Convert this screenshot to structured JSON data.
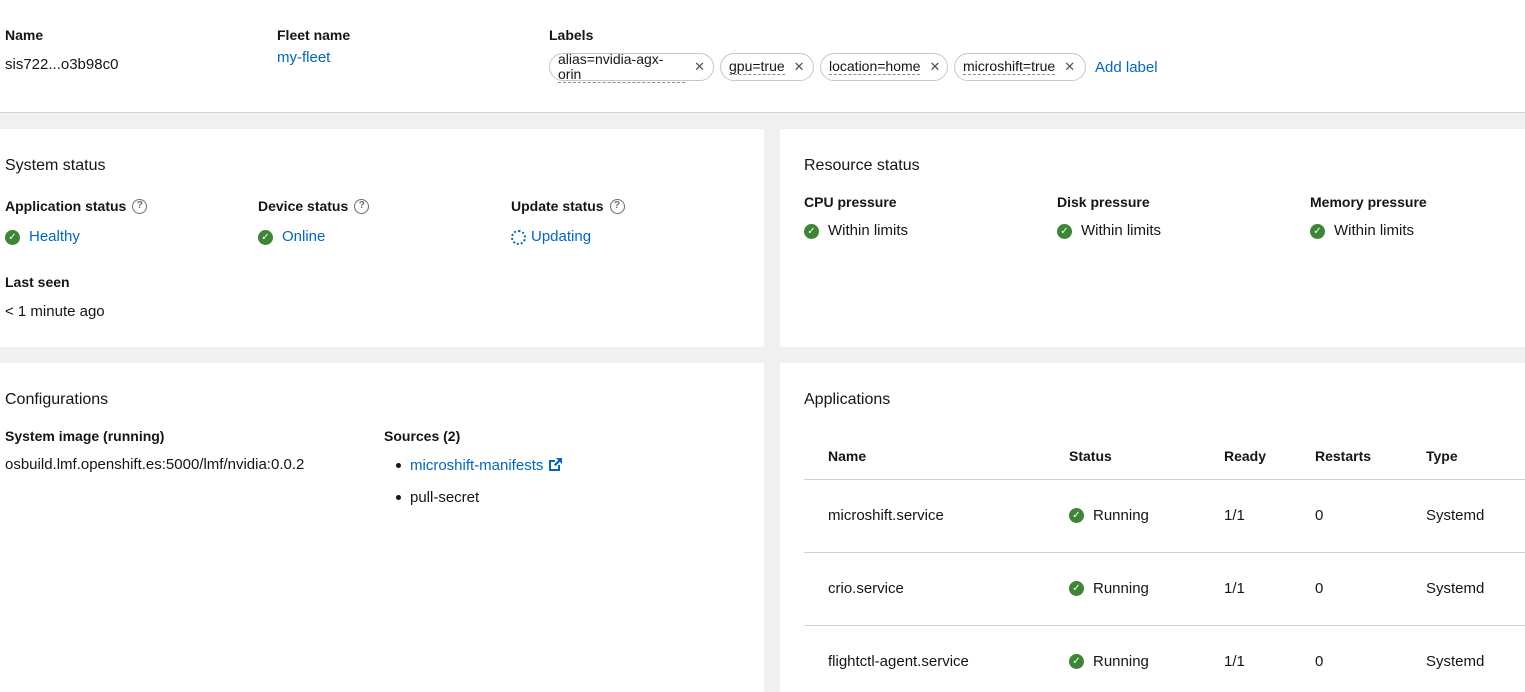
{
  "header": {
    "name_label": "Name",
    "name_value": "sis722...o3b98c0",
    "fleet_label": "Fleet name",
    "fleet_value": "my-fleet",
    "labels_label": "Labels",
    "labels": [
      "alias=nvidia-agx-orin",
      "gpu=true",
      "location=home",
      "microshift=true"
    ],
    "add_label": "Add label"
  },
  "system_status": {
    "title": "System status",
    "app_status_label": "Application status",
    "app_status_value": "Healthy",
    "device_status_label": "Device status",
    "device_status_value": "Online",
    "update_status_label": "Update status",
    "update_status_value": "Updating",
    "last_seen_label": "Last seen",
    "last_seen_value": "< 1 minute ago"
  },
  "resource_status": {
    "title": "Resource status",
    "cpu_label": "CPU pressure",
    "cpu_value": "Within limits",
    "disk_label": "Disk pressure",
    "disk_value": "Within limits",
    "memory_label": "Memory pressure",
    "memory_value": "Within limits"
  },
  "configurations": {
    "title": "Configurations",
    "system_image_label": "System image (running)",
    "system_image_value": "osbuild.lmf.openshift.es:5000/lmf/nvidia:0.0.2",
    "sources_label": "Sources (2)",
    "sources": [
      "microshift-manifests",
      "pull-secret"
    ]
  },
  "applications": {
    "title": "Applications",
    "columns": [
      "Name",
      "Status",
      "Ready",
      "Restarts",
      "Type"
    ],
    "rows": [
      {
        "name": "microshift.service",
        "status": "Running",
        "ready": "1/1",
        "restarts": "0",
        "type": "Systemd"
      },
      {
        "name": "crio.service",
        "status": "Running",
        "ready": "1/1",
        "restarts": "0",
        "type": "Systemd"
      },
      {
        "name": "flightctl-agent.service",
        "status": "Running",
        "ready": "1/1",
        "restarts": "0",
        "type": "Systemd"
      }
    ]
  },
  "colors": {
    "link": "#0066cc",
    "success": "#3e8635",
    "page_background": "#f0f0f0"
  },
  "icons": {
    "help": "help-icon",
    "success": "check-circle-icon",
    "in_progress": "spinner-icon",
    "external_link": "external-link-icon",
    "remove_label": "close-icon"
  }
}
